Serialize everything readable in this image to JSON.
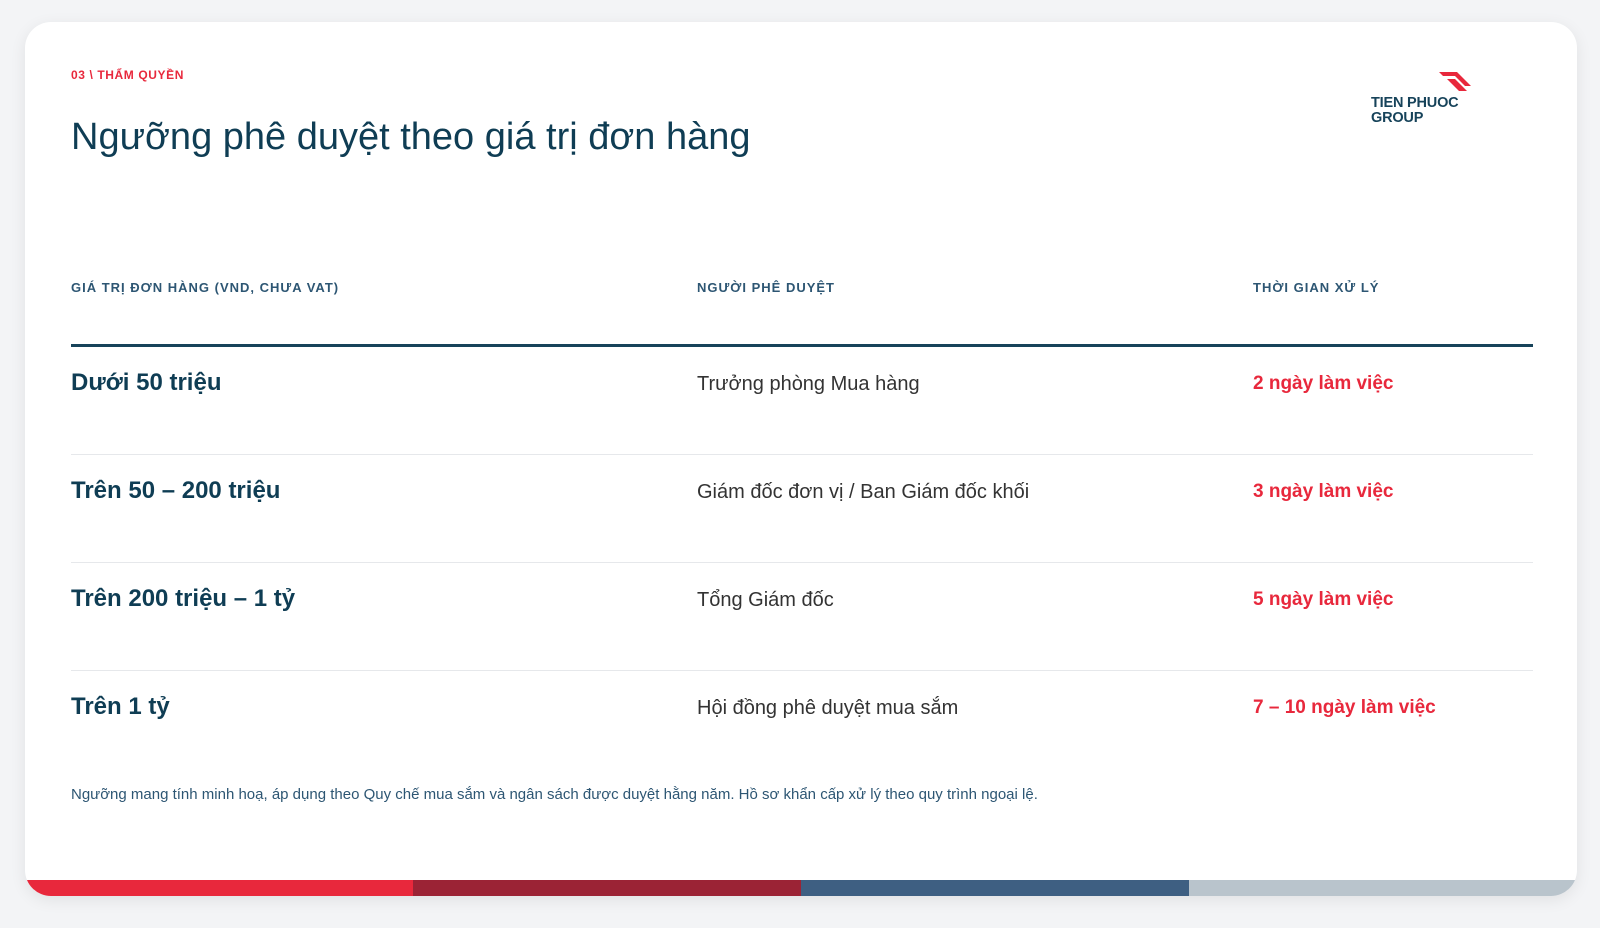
{
  "header": {
    "eyebrow": "03 \\ THẨM QUYỀN",
    "title": "Ngưỡng phê duyệt theo giá trị đơn hàng"
  },
  "logo": {
    "line1": "TIEN PHUOC",
    "line2": "GROUP",
    "icon": "tien-phuoc-logo-icon"
  },
  "table": {
    "headers": {
      "value": "GIÁ TRỊ ĐƠN HÀNG (VND, CHƯA VAT)",
      "approver": "NGƯỜI PHÊ DUYỆT",
      "time": "THỜI GIAN XỬ LÝ"
    },
    "rows": [
      {
        "value": "Dưới 50 triệu",
        "approver": "Trưởng phòng Mua hàng",
        "time": "2 ngày làm việc"
      },
      {
        "value": "Trên 50 – 200 triệu",
        "approver": "Giám đốc đơn vị / Ban Giám đốc khối",
        "time": "3 ngày làm việc"
      },
      {
        "value": "Trên 200 triệu – 1 tỷ",
        "approver": "Tổng Giám đốc",
        "time": "5 ngày làm việc"
      },
      {
        "value": "Trên 1 tỷ",
        "approver": "Hội đồng phê duyệt mua sắm",
        "time": "7 – 10 ngày làm việc"
      }
    ]
  },
  "footnote": "Ngưỡng mang tính minh hoạ, áp dụng theo Quy chế mua sắm và ngân sách được duyệt hằng năm. Hồ sơ khẩn cấp xử lý theo quy trình ngoại lệ.",
  "colors": {
    "accent_red": "#e8283c",
    "navy": "#0f3d54",
    "bar": [
      "#e8283c",
      "#9b2335",
      "#3e5f82",
      "#b9c4cc"
    ]
  }
}
